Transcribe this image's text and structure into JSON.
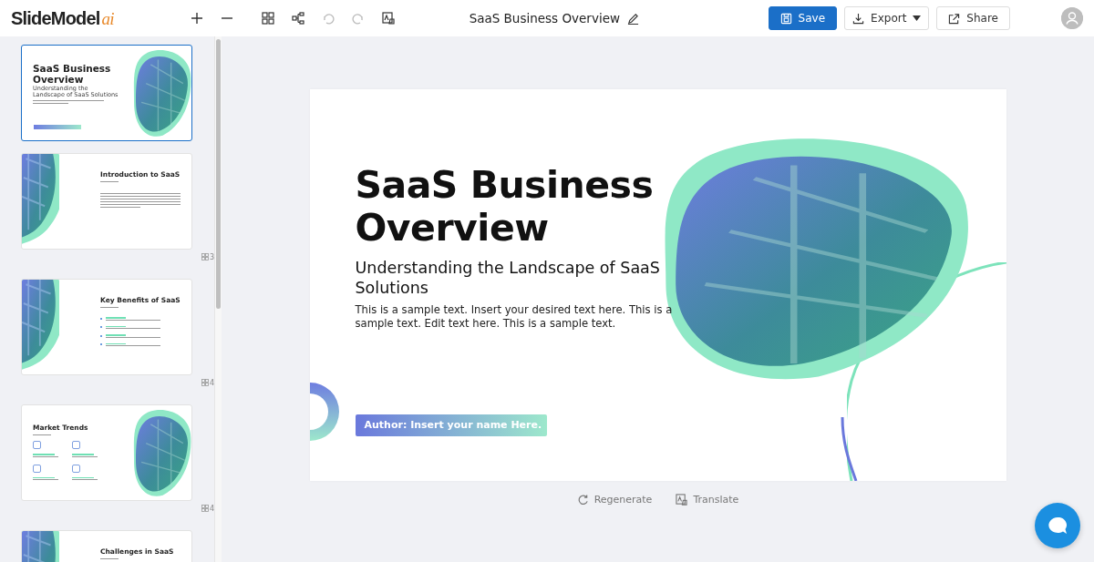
{
  "header": {
    "logo": {
      "name": "SlideModel",
      "suffix": "ai"
    },
    "toolbar": [
      {
        "kind": "plus",
        "disabled": false
      },
      {
        "kind": "minus",
        "disabled": false
      },
      {
        "kind": "grid",
        "disabled": false
      },
      {
        "kind": "tree",
        "disabled": false
      },
      {
        "kind": "undo",
        "disabled": true
      },
      {
        "kind": "redo",
        "disabled": true
      },
      {
        "kind": "image",
        "disabled": false
      }
    ],
    "title": "SaaS Business Overview",
    "buttons": [
      {
        "kind": "save",
        "label": "Save"
      },
      {
        "kind": "export",
        "label": "Export"
      },
      {
        "kind": "share",
        "label": "Share"
      }
    ]
  },
  "slides": [
    {
      "kind": "cover",
      "title": "SaaS Business Overview",
      "subtitle": "Understanding the Landscape of SaaS Solutions",
      "selected": true
    },
    {
      "kind": "intro",
      "title": "Introduction to SaaS",
      "count": "3",
      "selected": false
    },
    {
      "kind": "list",
      "title": "Key Benefits of SaaS",
      "count": "4",
      "selected": false
    },
    {
      "kind": "grid",
      "title": "Market Trends",
      "count": "4",
      "selected": false
    },
    {
      "kind": "intro",
      "title": "Challenges in SaaS",
      "selected": false
    }
  ],
  "slide": {
    "title": "SaaS Business Overview",
    "subtitle": "Understanding the Landscape of SaaS Solutions",
    "body": "This is a sample text. Insert your desired text here. This is a sample text. Edit text here. This is a sample text.",
    "author": "Author: Insert your name Here."
  },
  "actions": [
    {
      "kind": "regenerate",
      "label": "Regenerate"
    },
    {
      "kind": "translate",
      "label": "Translate"
    }
  ]
}
